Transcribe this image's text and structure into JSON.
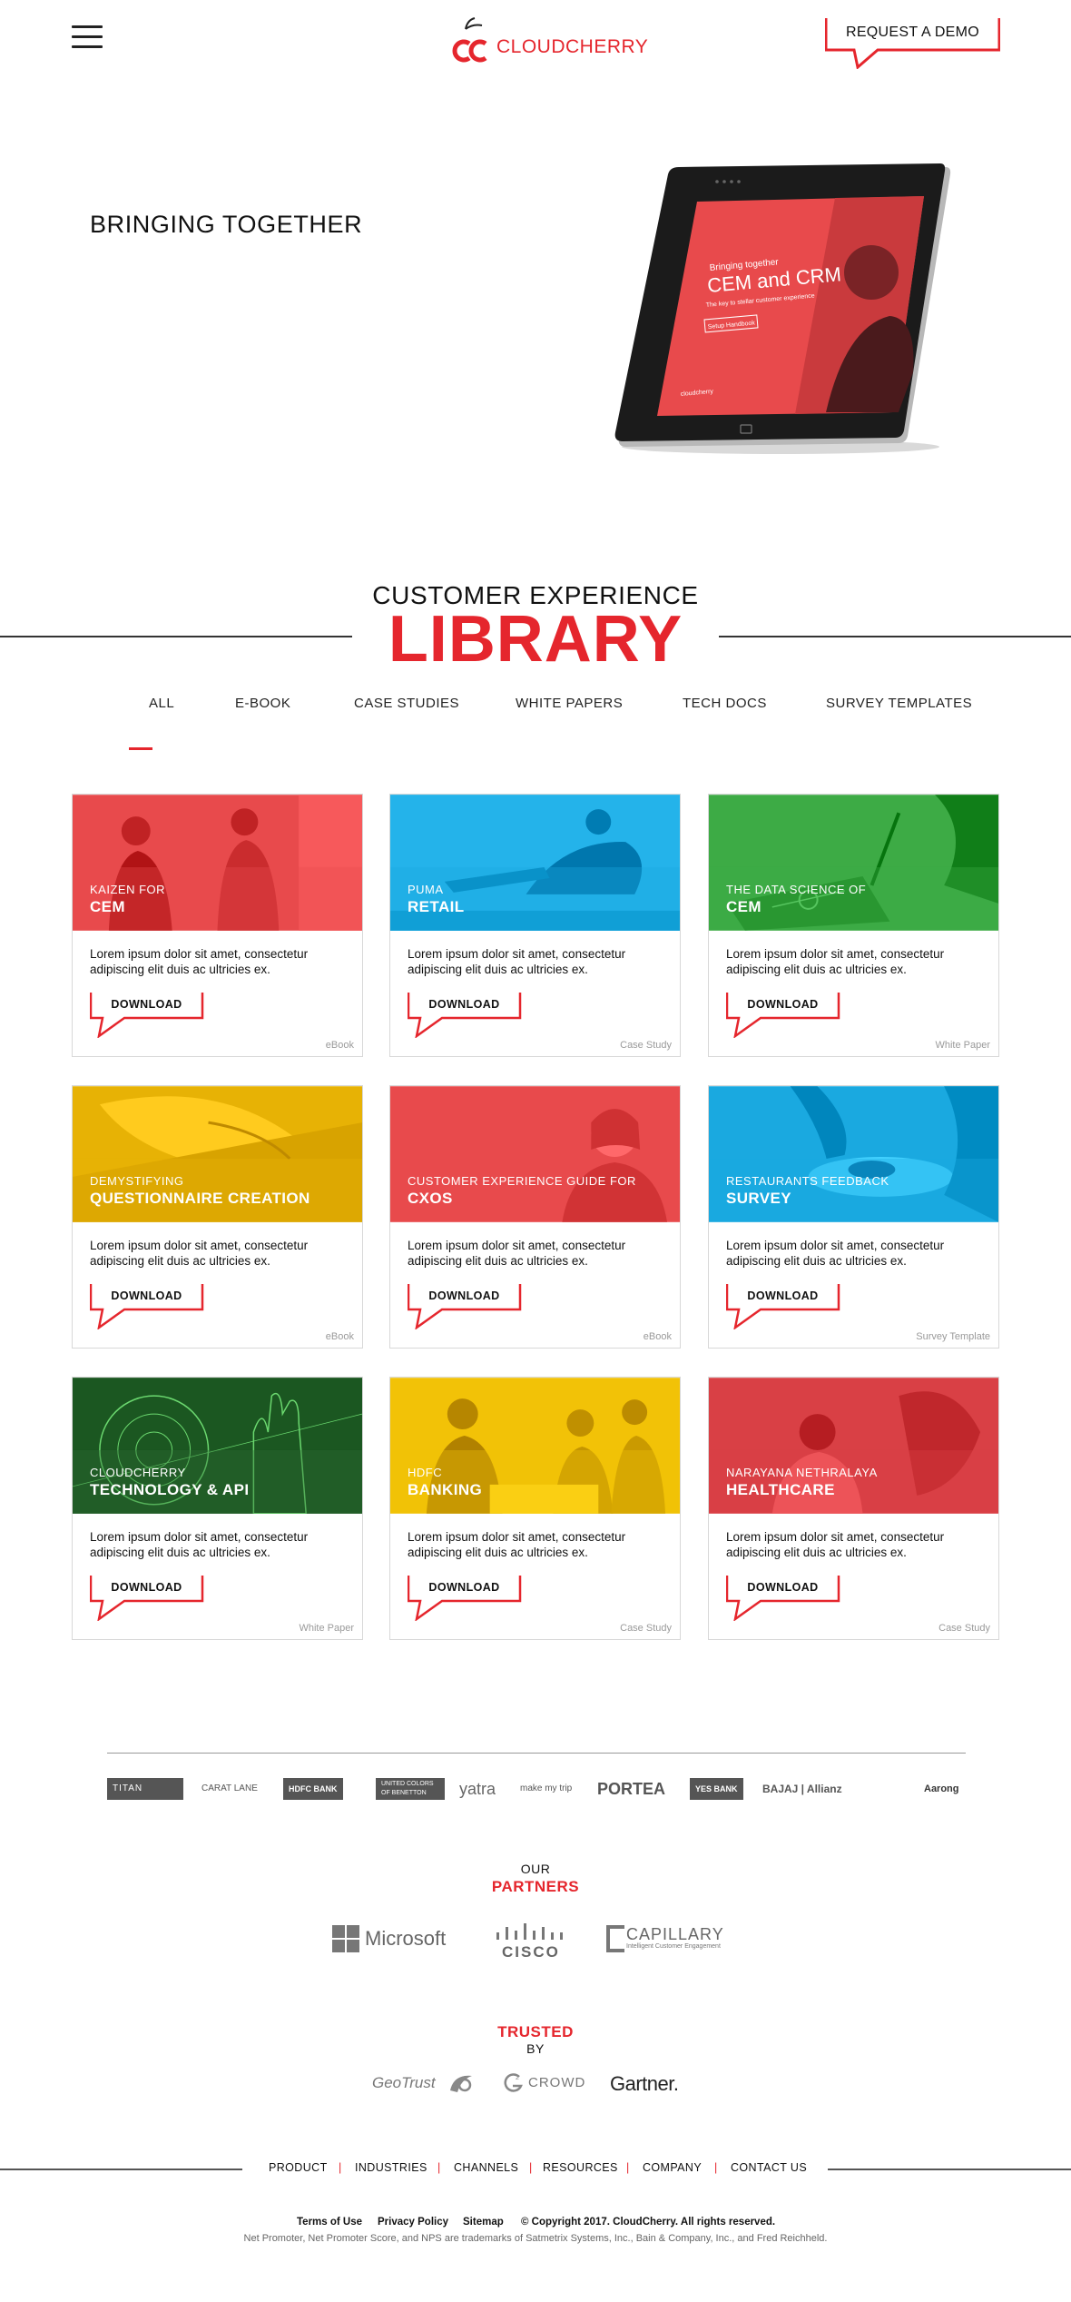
{
  "header": {
    "logo_text": "CLOUDCHERRY",
    "demo_label": "REQUEST A DEMO"
  },
  "hero": {
    "title": "BRINGING TOGETHER",
    "tablet_screen": {
      "small": "Bringing together",
      "big": "CEM and CRM",
      "sub": "The key to stellar customer experience",
      "cta": "Setup Handbook",
      "brand": "cloudcherry"
    }
  },
  "library": {
    "pre": "CUSTOMER EXPERIENCE",
    "title": "LIBRARY"
  },
  "tabs": [
    "ALL",
    "E-BOOK",
    "CASE STUDIES",
    "WHITE PAPERS",
    "TECH DOCS",
    "SURVEY TEMPLATES"
  ],
  "active_tab": "ALL",
  "cards": [
    {
      "kicker": "KAIZEN FOR",
      "heading": "CEM",
      "desc": "Lorem ipsum dolor sit amet, consectetur adipiscing elit duis ac ultricies ex.",
      "button": "DOWNLOAD",
      "type": "eBook",
      "color": "#e84a4c",
      "icon": "business-people-image"
    },
    {
      "kicker": "PUMA",
      "heading": "RETAIL",
      "desc": "Lorem ipsum dolor sit amet, consectetur adipiscing elit duis ac ultricies ex.",
      "button": "DOWNLOAD",
      "type": "Case Study",
      "color": "#1aa9e0",
      "icon": "runner-stretching-image"
    },
    {
      "kicker": "THE DATA SCIENCE OF",
      "heading": "CEM",
      "desc": "Lorem ipsum dolor sit amet, consectetur adipiscing elit duis ac ultricies ex.",
      "button": "DOWNLOAD",
      "type": "White Paper",
      "color": "#3dab45",
      "icon": "tablet-data-image"
    },
    {
      "kicker": "DEMYSTIFYING",
      "heading": "QUESTIONNAIRE CREATION",
      "desc": "Lorem ipsum dolor sit amet, consectetur adipiscing elit duis ac ultricies ex.",
      "button": "DOWNLOAD",
      "type": "eBook",
      "color": "#e7b205",
      "icon": "hand-writing-image"
    },
    {
      "kicker": "CUSTOMER EXPERIENCE GUIDE FOR",
      "heading": "CXOs",
      "desc": "Lorem ipsum dolor sit amet, consectetur adipiscing elit duis ac ultricies ex.",
      "button": "DOWNLOAD",
      "type": "eBook",
      "color": "#e84a4c",
      "icon": "smiling-woman-image"
    },
    {
      "kicker": "RESTAURANTS FEEDBACK",
      "heading": "SURVEY",
      "desc": "Lorem ipsum dolor sit amet, consectetur adipiscing elit duis ac ultricies ex.",
      "button": "DOWNLOAD",
      "type": "Survey Template",
      "color": "#1aa9e0",
      "icon": "chef-plating-image"
    },
    {
      "kicker": "CLOUDCHERRY",
      "heading": "TECHNOLOGY & API",
      "desc": "Lorem ipsum dolor sit amet, consectetur adipiscing elit duis ac ultricies ex.",
      "button": "DOWNLOAD",
      "type": "White Paper",
      "color": "#2f6b35",
      "icon": "tech-hand-image"
    },
    {
      "kicker": "HDFC",
      "heading": "BANKING",
      "desc": "Lorem ipsum dolor sit amet, consectetur adipiscing elit duis ac ultricies ex.",
      "button": "DOWNLOAD",
      "type": "Case Study",
      "color": "#f2c207",
      "icon": "bank-meeting-image"
    },
    {
      "kicker": "NARAYANA NETHRALAYA",
      "heading": "HEALTHCARE",
      "desc": "Lorem ipsum dolor sit amet, consectetur adipiscing elit duis ac ultricies ex.",
      "button": "DOWNLOAD",
      "type": "Case Study",
      "color": "#d94045",
      "icon": "doctor-patient-image"
    }
  ],
  "clients": [
    "TITAN",
    "CARAT LANE",
    "HDFC BANK",
    "UNITED COLORS OF BENETTON",
    "yatra",
    "make my trip",
    "PORTEA",
    "YES BANK",
    "BAJAJ | Allianz",
    "Aarong"
  ],
  "partners": {
    "pre": "OUR",
    "title": "PARTNERS",
    "logos": [
      "Microsoft",
      "CISCO",
      "CAPILLARY"
    ],
    "capillary_tagline": "Intelligent Customer Engagement"
  },
  "trusted": {
    "title": "TRUSTED",
    "post": "BY",
    "logos": [
      "GeoTrust",
      "CROWD",
      "Gartner."
    ]
  },
  "footer": {
    "nav": [
      "PRODUCT",
      "INDUSTRIES",
      "CHANNELS",
      "RESOURCES",
      "COMPANY",
      "CONTACT US"
    ],
    "terms": "Terms of Use",
    "privacy": "Privacy Policy",
    "sitemap": "Sitemap",
    "copyright": "© Copyright 2017. CloudCherry. All rights reserved.",
    "trademark": "Net Promoter, Net Promoter Score, and NPS are trademarks of Satmetrix Systems, Inc., Bain & Company, Inc., and Fred Reichheld."
  },
  "colors": {
    "brand_red": "#e5262d",
    "text": "#222222",
    "muted": "#9a9a9a"
  }
}
